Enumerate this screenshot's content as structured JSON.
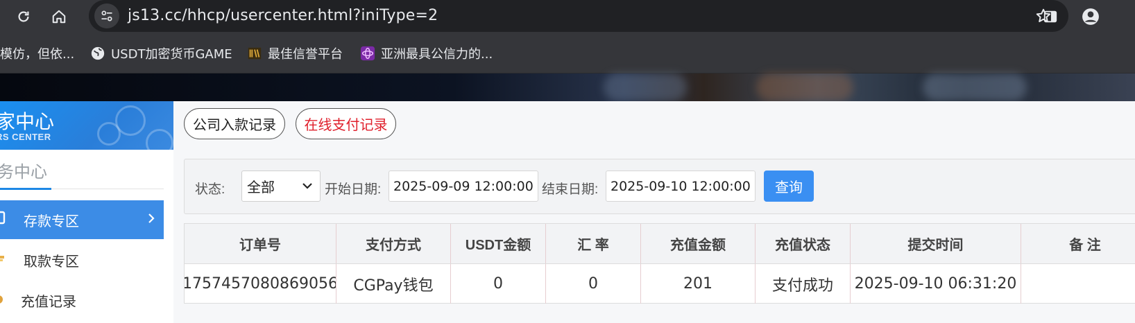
{
  "browser": {
    "url": "js13.cc/hhcp/usercenter.html?iniType=2",
    "bookmarks": [
      {
        "label": "模仿，但依...",
        "icon": "none"
      },
      {
        "label": "USDT加密货币GAME",
        "icon": "globe-icon"
      },
      {
        "label": "最佳信誉平台",
        "icon": "site-logo-icon"
      },
      {
        "label": "亚洲最具公信力的...",
        "icon": "site-logo-icon"
      }
    ]
  },
  "sidebar": {
    "header_title": "家中心",
    "header_subtitle": "RS CENTER",
    "section_title": "务中心",
    "items": [
      {
        "label": "存款专区",
        "active": true
      },
      {
        "label": "取款专区",
        "active": false
      },
      {
        "label": "充值记录",
        "active": false
      }
    ]
  },
  "tabs": [
    {
      "label": "公司入款记录",
      "active": false
    },
    {
      "label": "在线支付记录",
      "active": true
    }
  ],
  "filter": {
    "status_label": "状态:",
    "status_value": "全部",
    "start_label": "开始日期:",
    "start_value": "2025-09-09 12:00:00",
    "end_label": "结束日期:",
    "end_value": "2025-09-10 12:00:00",
    "query_label": "查询"
  },
  "table": {
    "headers": [
      "订单号",
      "支付方式",
      "USDT金额",
      "汇 率",
      "充值金额",
      "充值状态",
      "提交时间",
      "备 注"
    ],
    "rows": [
      [
        "1757457080869056",
        "CGPay钱包",
        "0",
        "0",
        "201",
        "支付成功",
        "2025-09-10 06:31:20",
        ""
      ]
    ]
  },
  "colors": {
    "accent": "#3a8ff2",
    "active_tab_text": "#e0202c",
    "sidebar_active": "#3c8ce6"
  }
}
